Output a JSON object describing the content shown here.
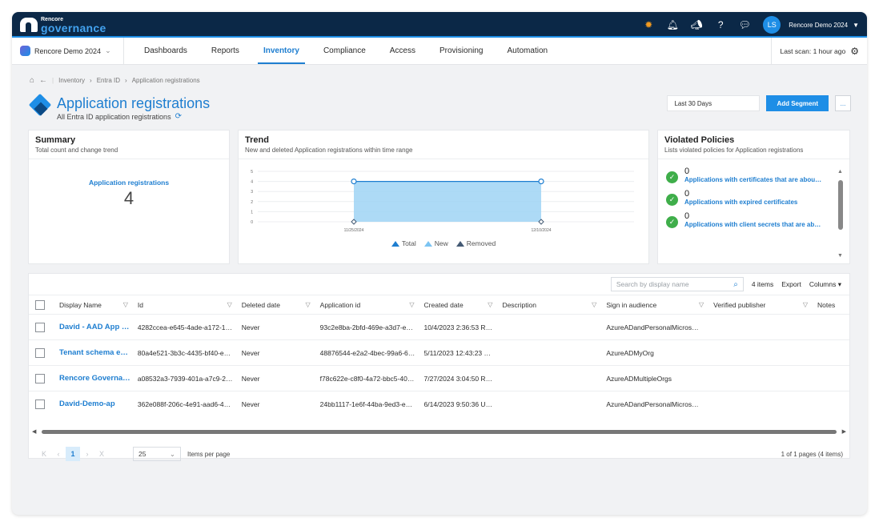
{
  "app": {
    "brand_small": "Rencore",
    "brand_big": "governance",
    "user_initials": "LS",
    "tenant_name": "Rencore Demo 2024"
  },
  "nav": {
    "tenant": "Rencore Demo 2024",
    "tabs": [
      "Dashboards",
      "Reports",
      "Inventory",
      "Compliance",
      "Access",
      "Provisioning",
      "Automation"
    ],
    "active_tab": "Inventory",
    "last_scan": "Last scan: 1 hour ago"
  },
  "breadcrumb": [
    "Inventory",
    "Entra ID",
    "Application registrations"
  ],
  "page": {
    "title": "Application registrations",
    "subtitle": "All Entra ID application registrations",
    "date_range": "Last 30 Days",
    "add_segment": "Add Segment",
    "more": "..."
  },
  "summary": {
    "title": "Summary",
    "subtitle": "Total count and change trend",
    "label": "Application registrations",
    "value": "4"
  },
  "trend": {
    "title": "Trend",
    "subtitle": "New and deleted Application registrations within time range",
    "legend": [
      "Total",
      "New",
      "Removed"
    ]
  },
  "chart_data": {
    "type": "area",
    "x": [
      "11/25/2024",
      "12/10/2024"
    ],
    "series": [
      {
        "name": "Total",
        "values": [
          4,
          4
        ]
      },
      {
        "name": "New",
        "values": [
          0,
          0
        ]
      },
      {
        "name": "Removed",
        "values": [
          0,
          0
        ]
      }
    ],
    "yticks": [
      "5",
      "4",
      "3",
      "2",
      "1",
      "0"
    ],
    "ylim": [
      0,
      5
    ]
  },
  "violated": {
    "title": "Violated Policies",
    "subtitle": "Lists violated policies for Application registrations",
    "items": [
      {
        "count": "0",
        "label": "Applications with certificates that are abou…"
      },
      {
        "count": "0",
        "label": "Applications with expired certificates"
      },
      {
        "count": "0",
        "label": "Applications with client secrets that are ab…"
      }
    ]
  },
  "table": {
    "search_placeholder": "Search by display name",
    "items_count": "4 items",
    "export": "Export",
    "columns": "Columns",
    "headers": [
      "Display Name",
      "Id",
      "Deleted date",
      "Application id",
      "Created date",
      "Description",
      "Sign in audience",
      "Verified publisher",
      "Notes"
    ],
    "rows": [
      [
        "David - AAD App …",
        "4282ccea-e645-4ade-a172-1…",
        "Never",
        "93c2e8ba-2bfd-469e-a3d7-e…",
        "10/4/2023 2:36:53 R…",
        "",
        "AzureADandPersonalMicros…",
        "",
        ""
      ],
      [
        "Tenant schema e…",
        "80a4e521-3b3c-4435-bf40-e…",
        "Never",
        "48876544-e2a2-4bec-99a6-6…",
        "5/11/2023 12:43:23 …",
        "",
        "AzureADMyOrg",
        "",
        ""
      ],
      [
        "Rencore Governa…",
        "a08532a3-7939-401a-a7c9-2…",
        "Never",
        "f78c622e-c8f0-4a72-bbc5-40…",
        "7/27/2024 3:04:50 R…",
        "",
        "AzureADMultipleOrgs",
        "",
        ""
      ],
      [
        "David-Demo-ap",
        "362e088f-206c-4e91-aad6-4…",
        "Never",
        "24bb1117-1e6f-44ba-9ed3-e…",
        "6/14/2023 9:50:36 U…",
        "",
        "AzureADandPersonalMicros…",
        "",
        ""
      ]
    ]
  },
  "pager": {
    "current_page": "1",
    "per_page": "25",
    "per_page_label": "Items per page",
    "info": "1 of 1 pages (4 items)"
  }
}
